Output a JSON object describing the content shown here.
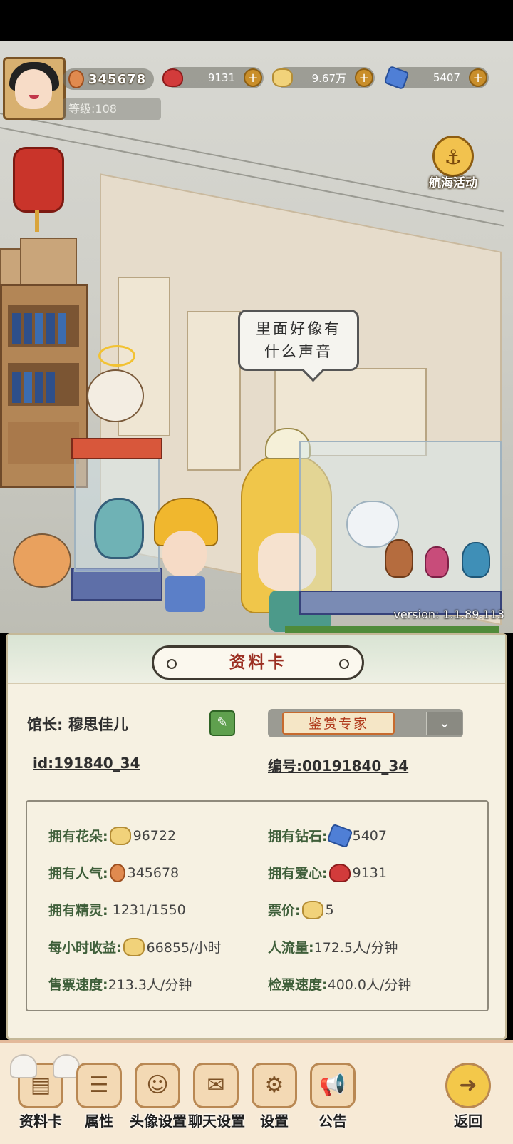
{
  "hud": {
    "popularity": "345678",
    "level": "等级:108",
    "hearts": "9131",
    "flowers": "9.67万",
    "diamonds": "5407",
    "plus_icon": "+",
    "voyage_label": "航海活动"
  },
  "scene": {
    "speech": "里面好像有\n什么声音",
    "version": "version: 1.1.89.113"
  },
  "card": {
    "title": "资料卡",
    "curator_label": "馆长:",
    "curator_name": "穆思佳儿",
    "honor_title": "鉴赏专家",
    "id": "id:191840_34",
    "serial": "编号:00191840_34",
    "stats": [
      {
        "label": "拥有花朵:",
        "icon": "flower-icon",
        "value": "96722"
      },
      {
        "label": "拥有钻石:",
        "icon": "diamond-icon",
        "value": "5407"
      },
      {
        "label": "拥有人气:",
        "icon": "balloon-icon",
        "value": "345678"
      },
      {
        "label": "拥有爱心:",
        "icon": "heart-icon",
        "value": "9131"
      },
      {
        "label": "拥有精灵:",
        "icon": "",
        "value": "1231/1550"
      },
      {
        "label": "票价:",
        "icon": "flower-icon",
        "value": "5"
      },
      {
        "label": "每小时收益:",
        "icon": "flower-icon",
        "value": "66855/小时"
      },
      {
        "label": "人流量:",
        "icon": "",
        "value": "172.5人/分钟"
      },
      {
        "label": "售票速度:",
        "icon": "",
        "value": "213.3人/分钟"
      },
      {
        "label": "检票速度:",
        "icon": "",
        "value": "400.0人/分钟"
      }
    ]
  },
  "nav": [
    {
      "label": "资料卡",
      "icon": "profile-card-icon"
    },
    {
      "label": "属性",
      "icon": "attributes-icon"
    },
    {
      "label": "头像设置",
      "icon": "avatar-settings-icon"
    },
    {
      "label": "聊天设置",
      "icon": "chat-settings-icon"
    },
    {
      "label": "设置",
      "icon": "settings-icon"
    },
    {
      "label": "公告",
      "icon": "announcement-icon"
    },
    {
      "label": "返回",
      "icon": "back-icon"
    }
  ],
  "colors": {
    "card_title": "#9b2f22",
    "stat_label": "#3f5f3a",
    "edit_button": "#5fa04e"
  }
}
